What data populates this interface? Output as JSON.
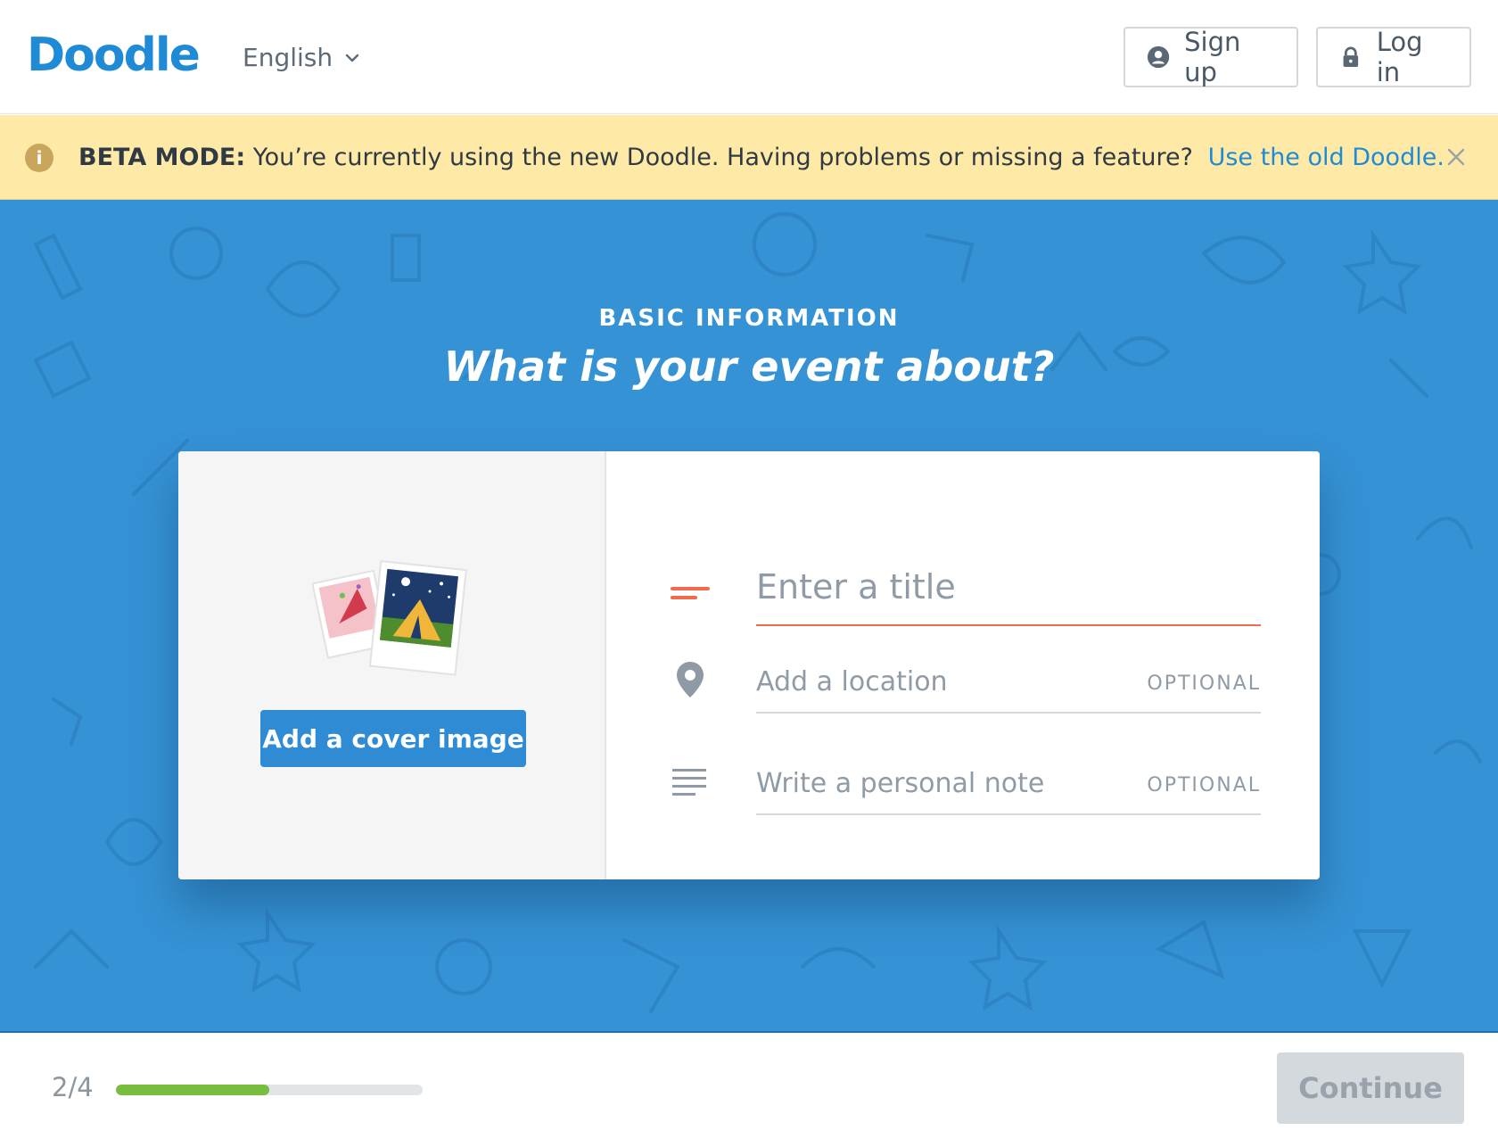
{
  "header": {
    "logo": "Doodle",
    "language": "English",
    "signup_label": "Sign up",
    "login_label": "Log in"
  },
  "banner": {
    "label": "BETA MODE:",
    "message": "You’re currently using the new Doodle. Having problems or missing a feature?",
    "link": "Use the old Doodle."
  },
  "hero": {
    "eyebrow": "BASIC INFORMATION",
    "headline": "What is your event about?"
  },
  "card": {
    "cover_button": "Add a cover image",
    "title_placeholder": "Enter a title",
    "location_placeholder": "Add a location",
    "location_optional": "OPTIONAL",
    "note_placeholder": "Write a personal note",
    "note_optional": "OPTIONAL"
  },
  "footer": {
    "step": "2/4",
    "progress_fraction": 0.5,
    "continue_label": "Continue"
  },
  "colors": {
    "brand_blue": "#1f8ad6",
    "hero_blue": "#3592d4",
    "banner_yellow": "#feeaa6",
    "title_accent": "#f36b4d",
    "progress_green": "#79bd3e"
  }
}
